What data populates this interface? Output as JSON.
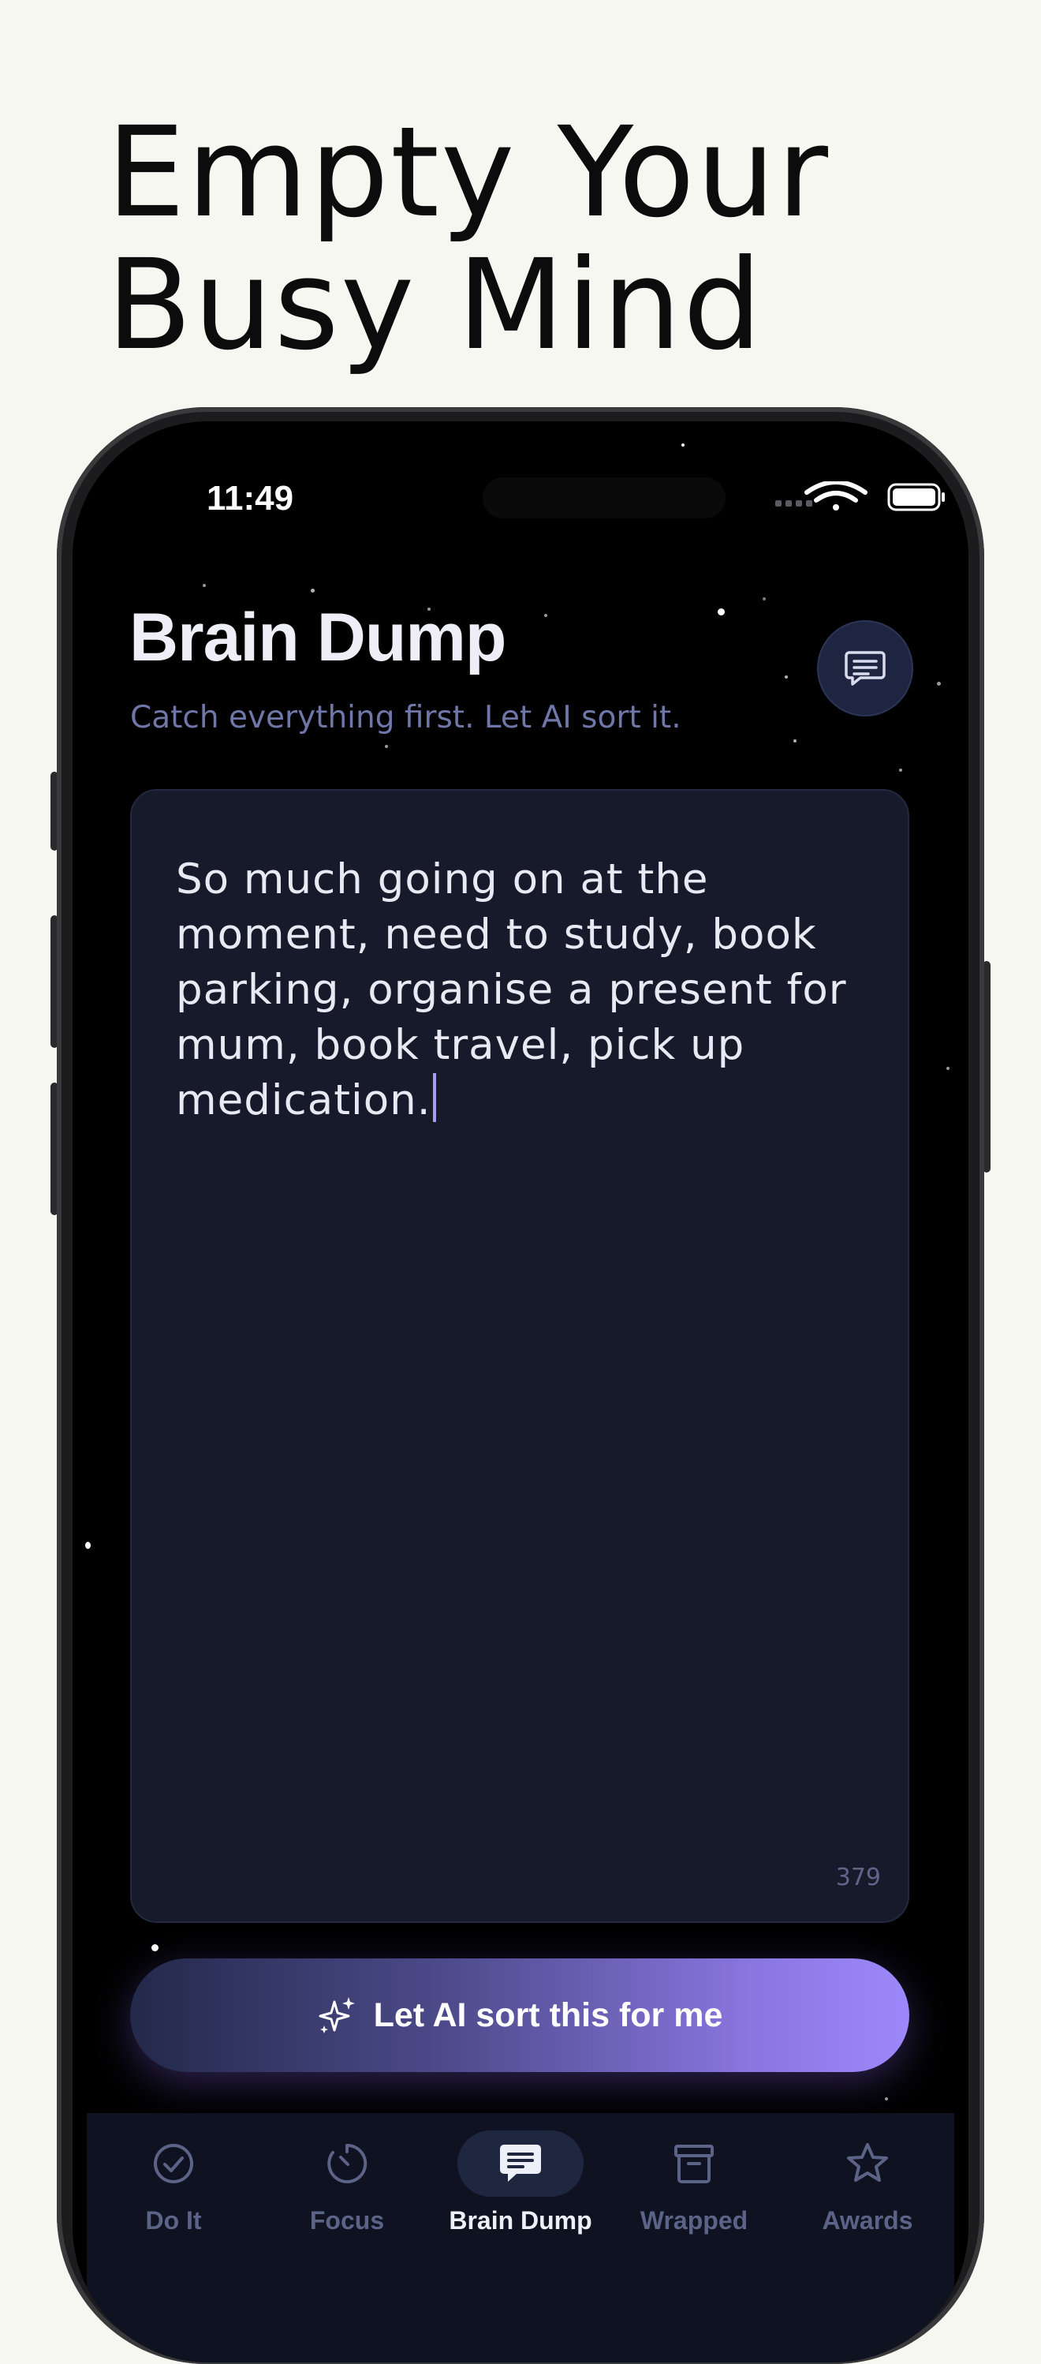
{
  "marketing": {
    "headline_line1": "Empty Your",
    "headline_line2": "Busy Mind"
  },
  "status_bar": {
    "time": "11:49"
  },
  "header": {
    "title": "Brain Dump",
    "subtitle": "Catch everything first. Let AI sort it."
  },
  "editor": {
    "text": "So much going on at the moment, need to study, book parking, organise a present for mum, book travel, pick up medication.",
    "char_count": "379"
  },
  "action": {
    "sort_label": "Let AI sort this for me"
  },
  "tabs": [
    {
      "label": "Do It",
      "icon": "check-circle-icon",
      "active": false
    },
    {
      "label": "Focus",
      "icon": "timer-icon",
      "active": false
    },
    {
      "label": "Brain Dump",
      "icon": "chat-bubble-icon",
      "active": true
    },
    {
      "label": "Wrapped",
      "icon": "archive-box-icon",
      "active": false
    },
    {
      "label": "Awards",
      "icon": "star-icon",
      "active": false
    }
  ],
  "colors": {
    "background": "#f7f7f1",
    "screen": "#000000",
    "card": "#161a2b",
    "accent": "#9d88fb",
    "muted": "#6f76a8"
  }
}
